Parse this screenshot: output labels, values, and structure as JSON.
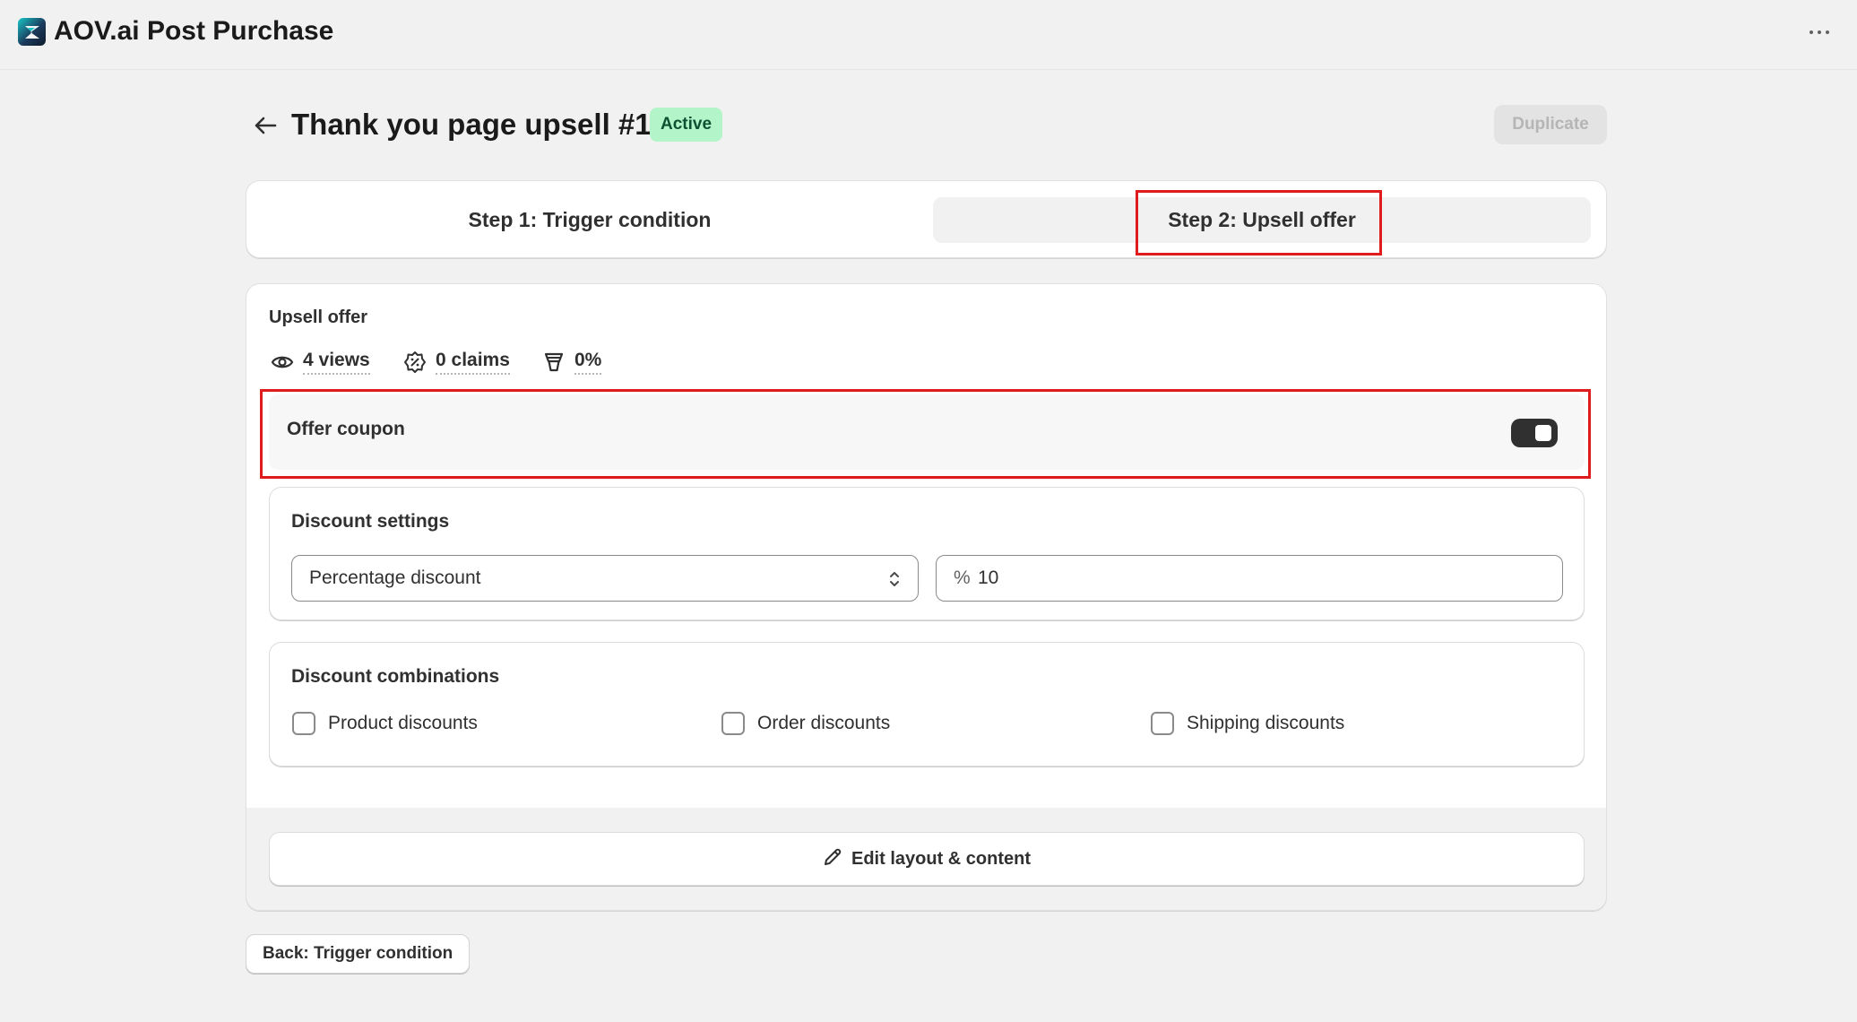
{
  "app": {
    "title": "AOV.ai Post Purchase",
    "logo_icon": "aov-logo-icon",
    "more_icon": "more-horizontal-icon"
  },
  "header": {
    "title": "Thank you page upsell #1",
    "status": "Active",
    "duplicate_label": "Duplicate",
    "back_icon": "arrow-left-icon"
  },
  "steps": [
    {
      "label": "Step 1: Trigger condition",
      "selected": false
    },
    {
      "label": "Step 2: Upsell offer",
      "selected": true
    }
  ],
  "upsell_offer": {
    "title": "Upsell offer",
    "stats": {
      "views": "4 views",
      "claims": "0 claims",
      "conversion": "0%"
    },
    "offer_coupon": {
      "label": "Offer coupon",
      "enabled": true
    }
  },
  "discount_settings": {
    "title": "Discount settings",
    "type": "Percentage discount",
    "value_prefix": "%",
    "value": "10"
  },
  "discount_combinations": {
    "title": "Discount combinations",
    "options": [
      {
        "label": "Product discounts",
        "checked": false
      },
      {
        "label": "Order discounts",
        "checked": false
      },
      {
        "label": "Shipping discounts",
        "checked": false
      }
    ]
  },
  "actions": {
    "edit_layout_label": "Edit layout & content",
    "back_label": "Back: Trigger condition"
  },
  "colors": {
    "background": "#f1f1f1",
    "badge_bg": "#b3f5c9",
    "badge_text": "#0c5132",
    "highlight": "#e01b1b",
    "toggle_on": "#303030"
  }
}
